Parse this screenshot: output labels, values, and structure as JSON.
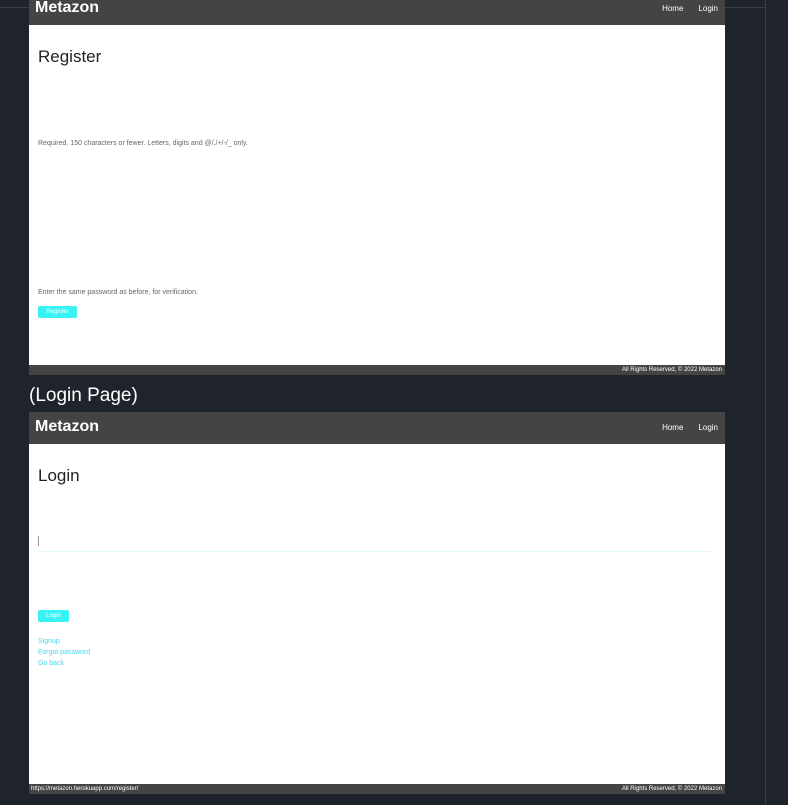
{
  "register_page": {
    "navbar": {
      "brand": "Metazon",
      "links": [
        "Home",
        "Login"
      ]
    },
    "heading": "Register",
    "username_help": "Required. 150 characters or fewer. Letters, digits and @/./+/-/_ only.",
    "password_help": "Enter the same password as before, for verification.",
    "submit_label": "Register",
    "footer": {
      "copyright": "All Rights Reserved, © 2022 Metazon"
    }
  },
  "section_label": "(Login Page)",
  "login_page": {
    "navbar": {
      "brand": "Metazon",
      "links": [
        "Home",
        "Login"
      ]
    },
    "heading": "Login",
    "submit_label": "Login",
    "links": [
      "Signup",
      "Forgot password",
      "Go back"
    ],
    "footer": {
      "copyright": "All Rights Reserved, © 2022 Metazon",
      "status_url": "https://metazon.herokuapp.com/register/"
    }
  },
  "colors": {
    "background": "#1e232c",
    "navbar": "#444444",
    "accent": "#38f3f3",
    "link": "#46d8e6"
  }
}
